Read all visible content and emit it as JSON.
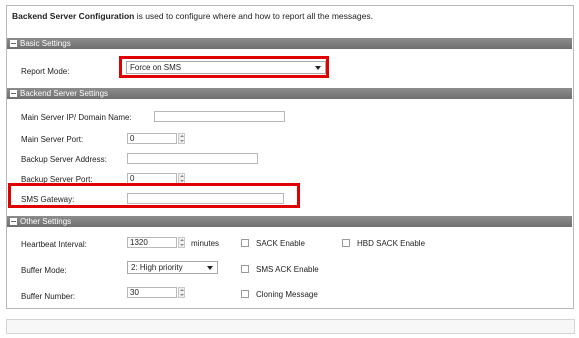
{
  "intro": {
    "bold": "Backend Server Configuration",
    "rest": " is used to configure where and how to report all the messages."
  },
  "sections": {
    "basic": "Basic Settings",
    "backend": "Backend Server Settings",
    "other": "Other Settings"
  },
  "basic": {
    "report_mode_label": "Report Mode:",
    "report_mode_value": "Force on SMS"
  },
  "backend": {
    "main_ip_label": "Main Server IP/ Domain Name:",
    "main_ip_value": "",
    "main_port_label": "Main Server Port:",
    "main_port_value": "0",
    "backup_addr_label": "Backup Server Address:",
    "backup_addr_value": "",
    "backup_port_label": "Backup Server Port:",
    "backup_port_value": "0",
    "sms_gateway_label": "SMS Gateway:",
    "sms_gateway_value": ""
  },
  "other": {
    "heartbeat_label": "Heartbeat Interval:",
    "heartbeat_value": "1320",
    "heartbeat_unit": "minutes",
    "buffer_mode_label": "Buffer Mode:",
    "buffer_mode_value": "2: High priority",
    "buffer_number_label": "Buffer Number:",
    "buffer_number_value": "30",
    "sack_enable": "SACK Enable",
    "hbd_sack_enable": "HBD SACK Enable",
    "sms_ack_enable": "SMS ACK Enable",
    "cloning_message": "Cloning Message"
  },
  "colors": {
    "highlight": "#e00000",
    "section_bar": "#7d7d7d"
  },
  "icons": {
    "collapse": "minus-square-icon",
    "spinner": "spinner-icon",
    "dropdown": "chevron-down-icon"
  }
}
